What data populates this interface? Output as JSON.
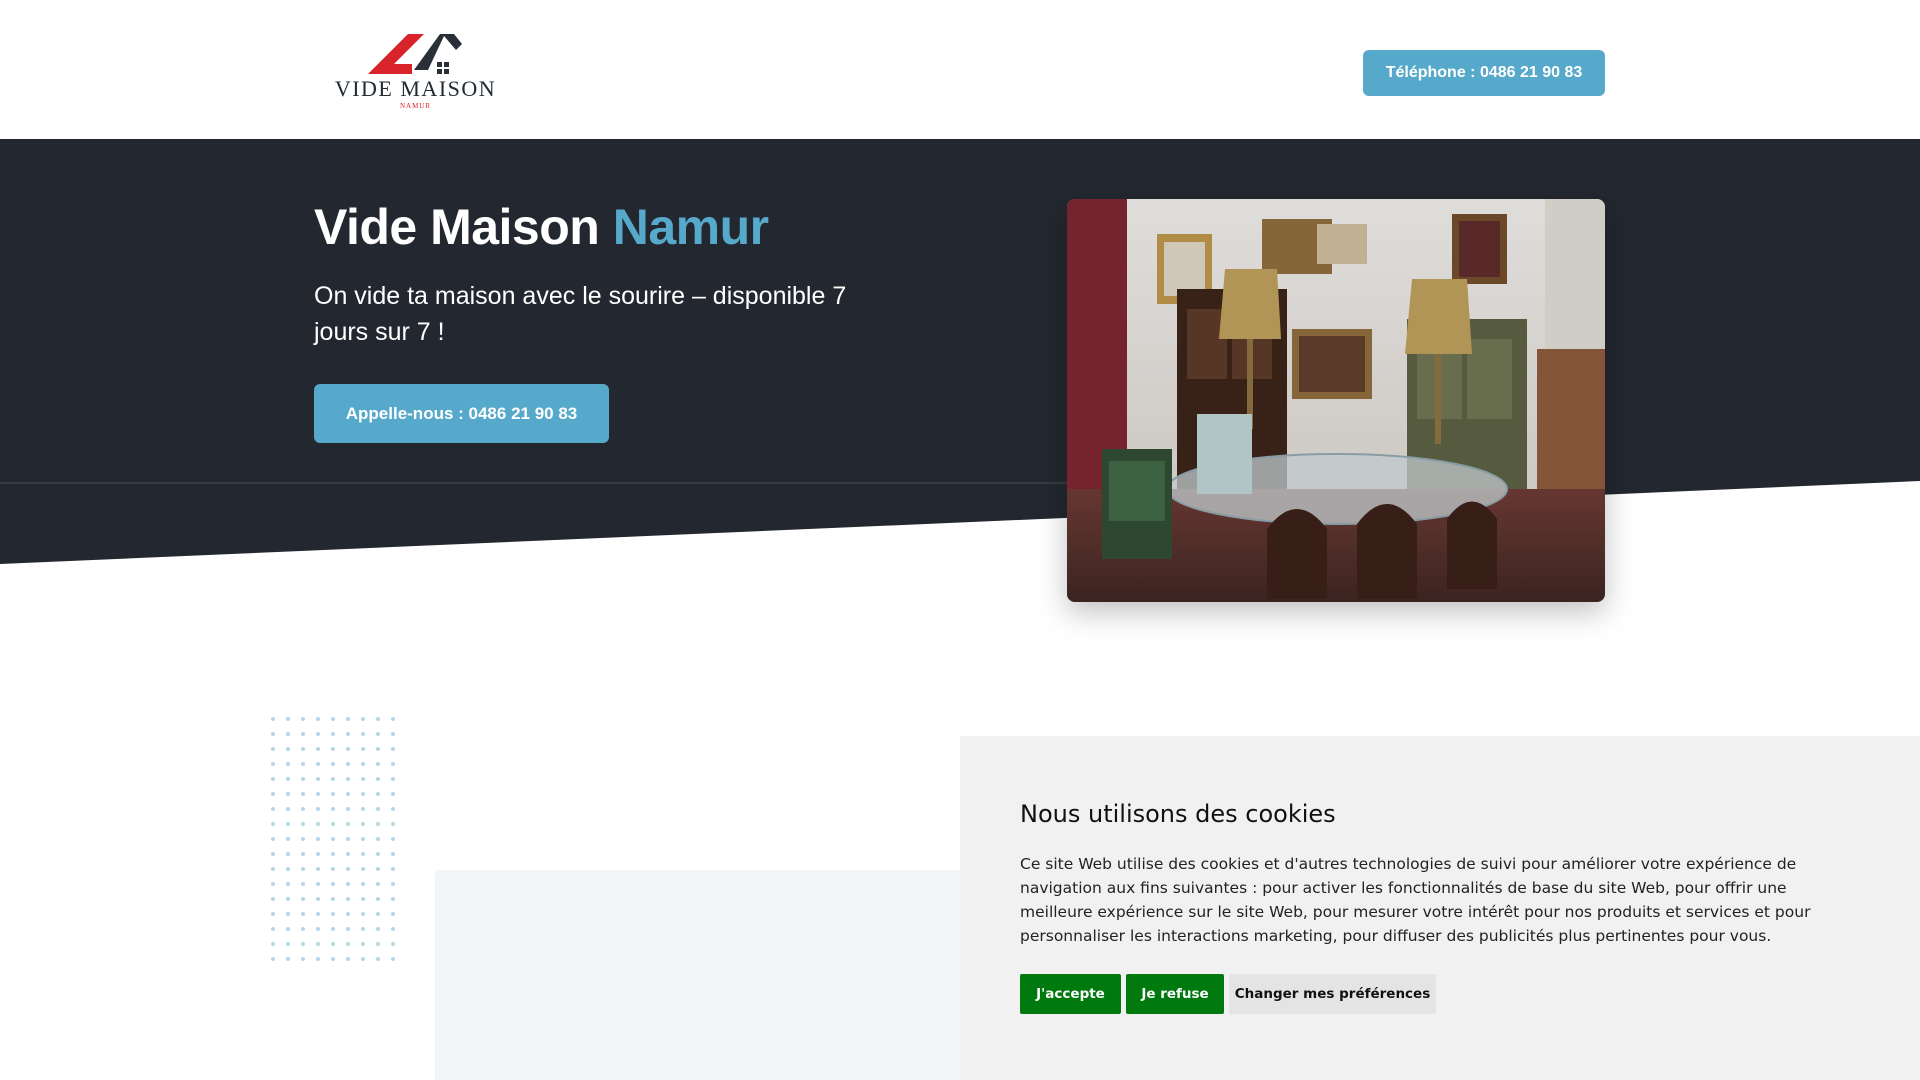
{
  "header": {
    "logo_text": "VIDE MAISON",
    "logo_subtext": "NAMUR",
    "phone_button": "Téléphone : 0486 21 90 83"
  },
  "hero": {
    "title_main": "Vide Maison",
    "title_accent": "Namur",
    "subtitle": "On vide ta maison avec le sourire – disponible 7 jours sur 7 !",
    "cta_button": "Appelle-nous : 0486 21 90 83"
  },
  "cookie_banner": {
    "title": "Nous utilisons des cookies",
    "text": "Ce site Web utilise des cookies et d'autres technologies de suivi pour améliorer votre expérience de navigation aux fins suivantes : pour activer les fonctionnalités de base du site Web, pour offrir une meilleure expérience sur le site Web, pour mesurer votre intérêt pour nos produits et services et pour personnaliser les interactions marketing, pour diffuser des publicités plus pertinentes pour vous.",
    "accept_button": "J'accepte",
    "refuse_button": "Je refuse",
    "preferences_button": "Changer mes préférences"
  },
  "colors": {
    "hero_background": "#23272f",
    "accent": "#56a9cb",
    "logo_red": "#d8232a",
    "cookie_button_green": "#007a0f"
  }
}
